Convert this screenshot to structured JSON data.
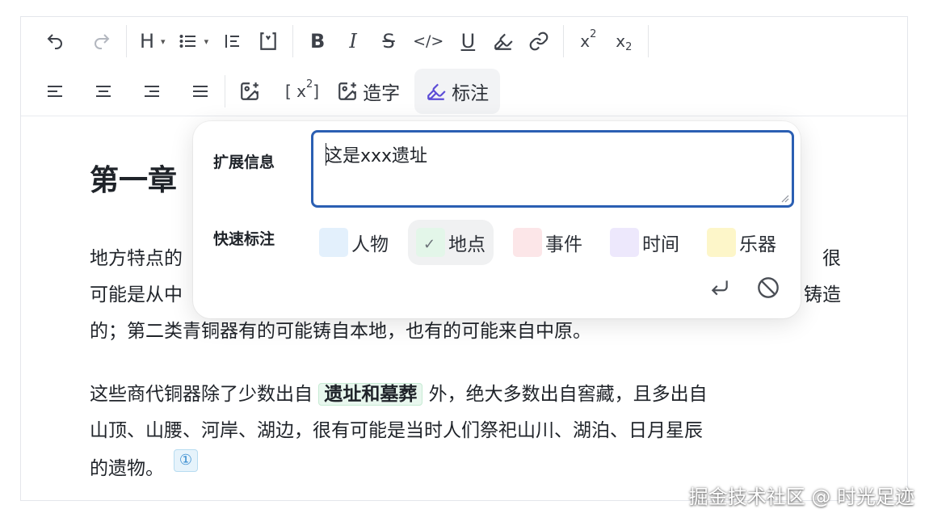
{
  "toolbar": {
    "row1": [
      {
        "name": "undo-icon"
      },
      {
        "name": "redo-icon"
      },
      {
        "name": "heading-icon",
        "label": "H"
      },
      {
        "name": "list-icon"
      },
      {
        "name": "indent-icon"
      },
      {
        "name": "quote-icon"
      },
      {
        "name": "bold-icon",
        "label": "B"
      },
      {
        "name": "italic-icon",
        "label": "I"
      },
      {
        "name": "strikethrough-icon",
        "label": "S"
      },
      {
        "name": "code-icon",
        "label": "</>"
      },
      {
        "name": "underline-icon",
        "label": "U"
      },
      {
        "name": "highlighter-icon"
      },
      {
        "name": "link-icon"
      },
      {
        "name": "superscript-icon",
        "label": "x",
        "sup": "2"
      },
      {
        "name": "subscript-icon",
        "label": "x",
        "sub": "2"
      }
    ],
    "row2": {
      "align_left": "align-left-icon",
      "align_center": "align-center-icon",
      "align_right": "align-right-icon",
      "align_justify": "align-justify-icon",
      "insert_image": "image-plus-icon",
      "formula_label": "[ x",
      "formula_sup": "2",
      "formula_close": " ]",
      "make_char_label": "造字",
      "annotate_label": "标注"
    }
  },
  "document": {
    "heading": "第一章",
    "para1_line1": "地方特点的",
    "para1_line1_right": "很",
    "para1_line2": "可能是从中",
    "para1_line2_right": "铸造",
    "para1_line3": "的；第二类青铜器有的可能铸自本地，也有的可能来自中原。",
    "para2_before": "这些商代铜器除了少数出自 ",
    "para2_highlight": "遗址和墓葬",
    "para2_after_line1": " 外，绝大多数出自窖藏，且多出自",
    "para2_line2": "山顶、山腰、河岸、湖边，很有可能是当时人们祭祀山川、湖泊、日月星辰",
    "para2_line3": "的遗物。",
    "note_marker": "①"
  },
  "popover": {
    "ext_label": "扩展信息",
    "ext_value": "这是xxx遗址",
    "quick_label": "快速标注",
    "chips": [
      {
        "label": "人物",
        "color": "#e3f0fc",
        "selected": false
      },
      {
        "label": "地点",
        "color": "#e3f6e9",
        "selected": true
      },
      {
        "label": "事件",
        "color": "#fce6e8",
        "selected": false
      },
      {
        "label": "时间",
        "color": "#ede8fc",
        "selected": false
      },
      {
        "label": "乐器",
        "color": "#fdf6c9",
        "selected": false
      }
    ],
    "confirm_icon": "enter-icon",
    "cancel_icon": "ban-icon"
  },
  "watermark": "掘金技术社区 @ 时光足迹",
  "colors": {
    "accent": "#2b5fb3",
    "annotate_icon": "#5b4bd6",
    "highlight_bg": "#e8f7ee"
  }
}
